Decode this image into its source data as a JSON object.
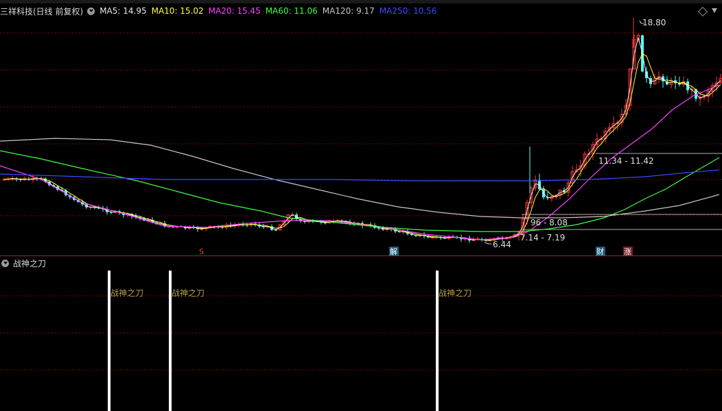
{
  "header": {
    "title": "三祥科技(日线 前复权)",
    "ma": [
      {
        "label": "MA5: 14.95",
        "color": "#e8e8e8"
      },
      {
        "label": "MA10: 15.02",
        "color": "#ffff40"
      },
      {
        "label": "MA20: 15.45",
        "color": "#ff40ff"
      },
      {
        "label": "MA60: 11.06",
        "color": "#40ff40"
      },
      {
        "label": "MA120: 9.17",
        "color": "#c8c8c8"
      },
      {
        "label": "MA250: 10.56",
        "color": "#3a4cff"
      }
    ]
  },
  "price_labels": {
    "high": "18.80",
    "low": "6.44",
    "range1": "11.34 - 11.42",
    "range2": "96 - 8.08",
    "range3": "7.14 - 7.19"
  },
  "markers": {
    "s": "S",
    "jie": "解",
    "cai": "财",
    "zhang": "涨"
  },
  "indicator": {
    "title": "战神之刀",
    "signals": [
      {
        "label": "战神之刀"
      },
      {
        "label": "战神之刀"
      },
      {
        "label": "战神之刀"
      }
    ]
  },
  "colors": {
    "up": "#ff3232",
    "down": "#54fcfc",
    "grid": "#8b0000"
  }
}
